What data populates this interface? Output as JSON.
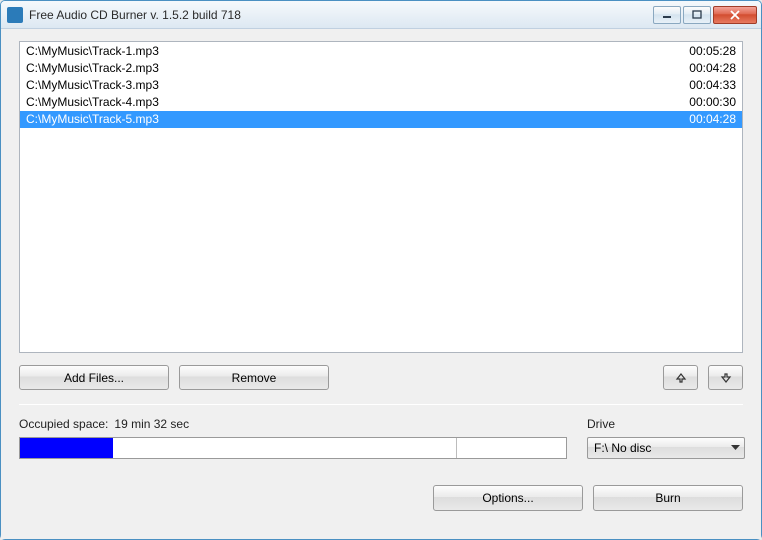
{
  "window": {
    "title": "Free Audio CD Burner  v. 1.5.2 build 718"
  },
  "tracks": [
    {
      "path": "C:\\MyMusic\\Track-1.mp3",
      "duration": "00:05:28",
      "selected": false
    },
    {
      "path": "C:\\MyMusic\\Track-2.mp3",
      "duration": "00:04:28",
      "selected": false
    },
    {
      "path": "C:\\MyMusic\\Track-3.mp3",
      "duration": "00:04:33",
      "selected": false
    },
    {
      "path": "C:\\MyMusic\\Track-4.mp3",
      "duration": "00:00:30",
      "selected": false
    },
    {
      "path": "C:\\MyMusic\\Track-5.mp3",
      "duration": "00:04:28",
      "selected": true
    }
  ],
  "buttons": {
    "add_files": "Add Files...",
    "remove": "Remove",
    "options": "Options...",
    "burn": "Burn"
  },
  "occupied": {
    "label": "Occupied space:",
    "value": "19 min 32 sec",
    "fill_percent": 17,
    "divider_percent": 80
  },
  "drive": {
    "label": "Drive",
    "value": "F:\\ No disc"
  }
}
